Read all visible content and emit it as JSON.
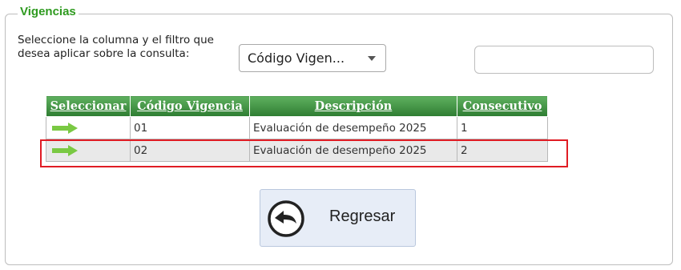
{
  "panel": {
    "legend": "Vigencias"
  },
  "filter": {
    "label": "Seleccione la columna y el filtro que desea aplicar sobre la consulta:",
    "selected_column": "Código Vigen...",
    "search_value": ""
  },
  "table": {
    "headers": [
      "Seleccionar",
      "Código Vigencia",
      "Descripción",
      "Consecutivo"
    ],
    "rows": [
      {
        "codigo": "01",
        "descripcion": "Evaluación de desempeño 2025",
        "consecutivo": "1"
      },
      {
        "codigo": "02",
        "descripcion": "Evaluación de desempeño 2025",
        "consecutivo": "2"
      }
    ]
  },
  "highlighted_row": 2,
  "back_button": {
    "label": "Regresar",
    "icon": "back-arrow-circle-icon"
  },
  "colors": {
    "legend": "#2e9a1f",
    "header": "#2e7d32",
    "select_arrow": "#7ac943",
    "highlight": "#e01c24"
  }
}
